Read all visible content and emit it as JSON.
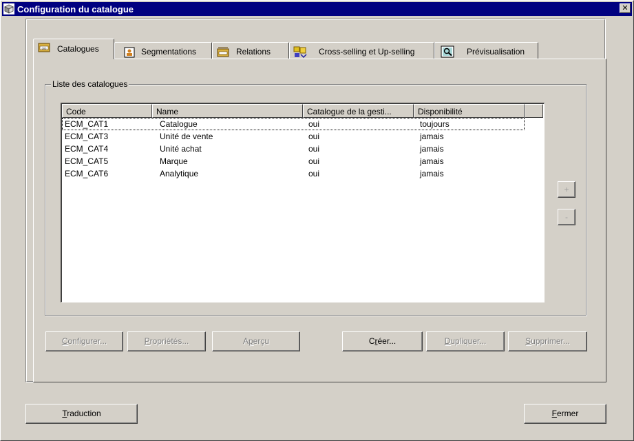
{
  "window": {
    "title": "Configuration du catalogue"
  },
  "tabs": [
    {
      "label": "Catalogues",
      "icon": "catalog-icon",
      "active": true
    },
    {
      "label": "Segmentations",
      "icon": "segmentation-icon",
      "active": false
    },
    {
      "label": "Relations",
      "icon": "relations-icon",
      "active": false
    },
    {
      "label": "Cross-selling et Up-selling",
      "icon": "cross-selling-icon",
      "active": false
    },
    {
      "label": "Prévisualisation",
      "icon": "preview-icon",
      "active": false
    }
  ],
  "group": {
    "title": "Liste des catalogues"
  },
  "list": {
    "columns": [
      "Code",
      "Name",
      "Catalogue de la gesti...",
      "Disponibilité"
    ],
    "rows": [
      {
        "code": "ECM_CAT1",
        "name": "Catalogue",
        "gestion": "oui",
        "dispo": "toujours"
      },
      {
        "code": "ECM_CAT3",
        "name": "Unité de vente",
        "gestion": "oui",
        "dispo": "jamais"
      },
      {
        "code": "ECM_CAT4",
        "name": "Unité achat",
        "gestion": "oui",
        "dispo": "jamais"
      },
      {
        "code": "ECM_CAT5",
        "name": "Marque",
        "gestion": "oui",
        "dispo": "jamais"
      },
      {
        "code": "ECM_CAT6",
        "name": "Analytique",
        "gestion": "oui",
        "dispo": "jamais"
      }
    ]
  },
  "side_buttons": {
    "plus": "+",
    "minus": "-"
  },
  "actions": {
    "configurer": {
      "key": "C",
      "rest": "onfigurer..."
    },
    "proprietes": {
      "key": "P",
      "rest": "ropriétés..."
    },
    "apercu": {
      "pre": "A",
      "key": "p",
      "rest": "erçu"
    },
    "creer": {
      "pre": "C",
      "key": "r",
      "rest": "éer..."
    },
    "dupliquer": {
      "key": "D",
      "rest": "upliquer..."
    },
    "supprimer": {
      "key": "S",
      "rest": "upprimer..."
    }
  },
  "footer": {
    "traduction": {
      "key": "T",
      "rest": "raduction"
    },
    "fermer": {
      "key": "F",
      "rest": "ermer"
    }
  },
  "colors": {
    "titlebar": "#000080",
    "face": "#d4d0c8",
    "list_bg": "#ffffff"
  }
}
